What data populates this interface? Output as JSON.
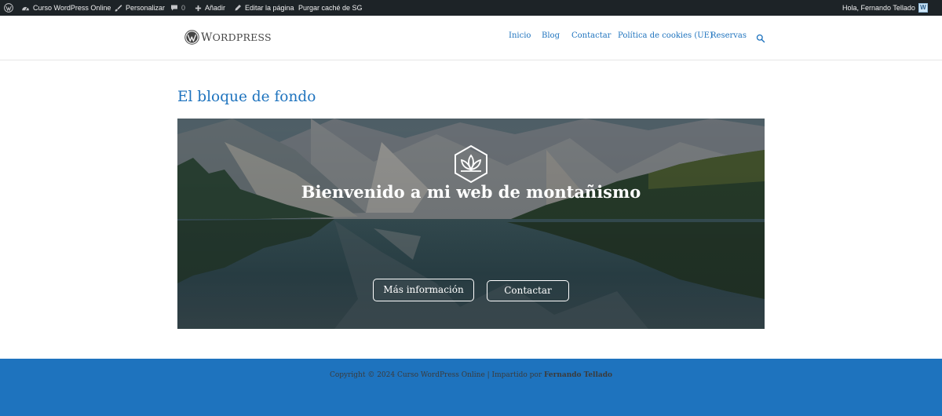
{
  "admin_bar": {
    "site_name": "Curso WordPress Online",
    "customize": "Personalizar",
    "comments_count": "0",
    "add_new": "Añadir",
    "edit_page": "Editar la página",
    "purge_cache": "Purgar caché de SG",
    "greeting": "Hola, Fernando Tellado"
  },
  "header": {
    "logo_text_first": "W",
    "logo_text_rest": "ORDPRESS",
    "nav": [
      "Inicio",
      "Blog",
      "Contactar",
      "Política de cookies (UE)",
      "Reservas"
    ]
  },
  "content": {
    "title": "El bloque de fondo",
    "cover": {
      "heading": "Bienvenido a mi web de montañismo",
      "buttons": [
        "Más información",
        "Contactar"
      ]
    }
  },
  "footer": {
    "text": "Copyright © 2024 Curso WordPress Online | Impartido por ",
    "author": "Fernando Tellado"
  },
  "colors": {
    "admin_bar": "#1d2327",
    "accent": "#1e73be",
    "footer_bg": "#1e73be"
  }
}
